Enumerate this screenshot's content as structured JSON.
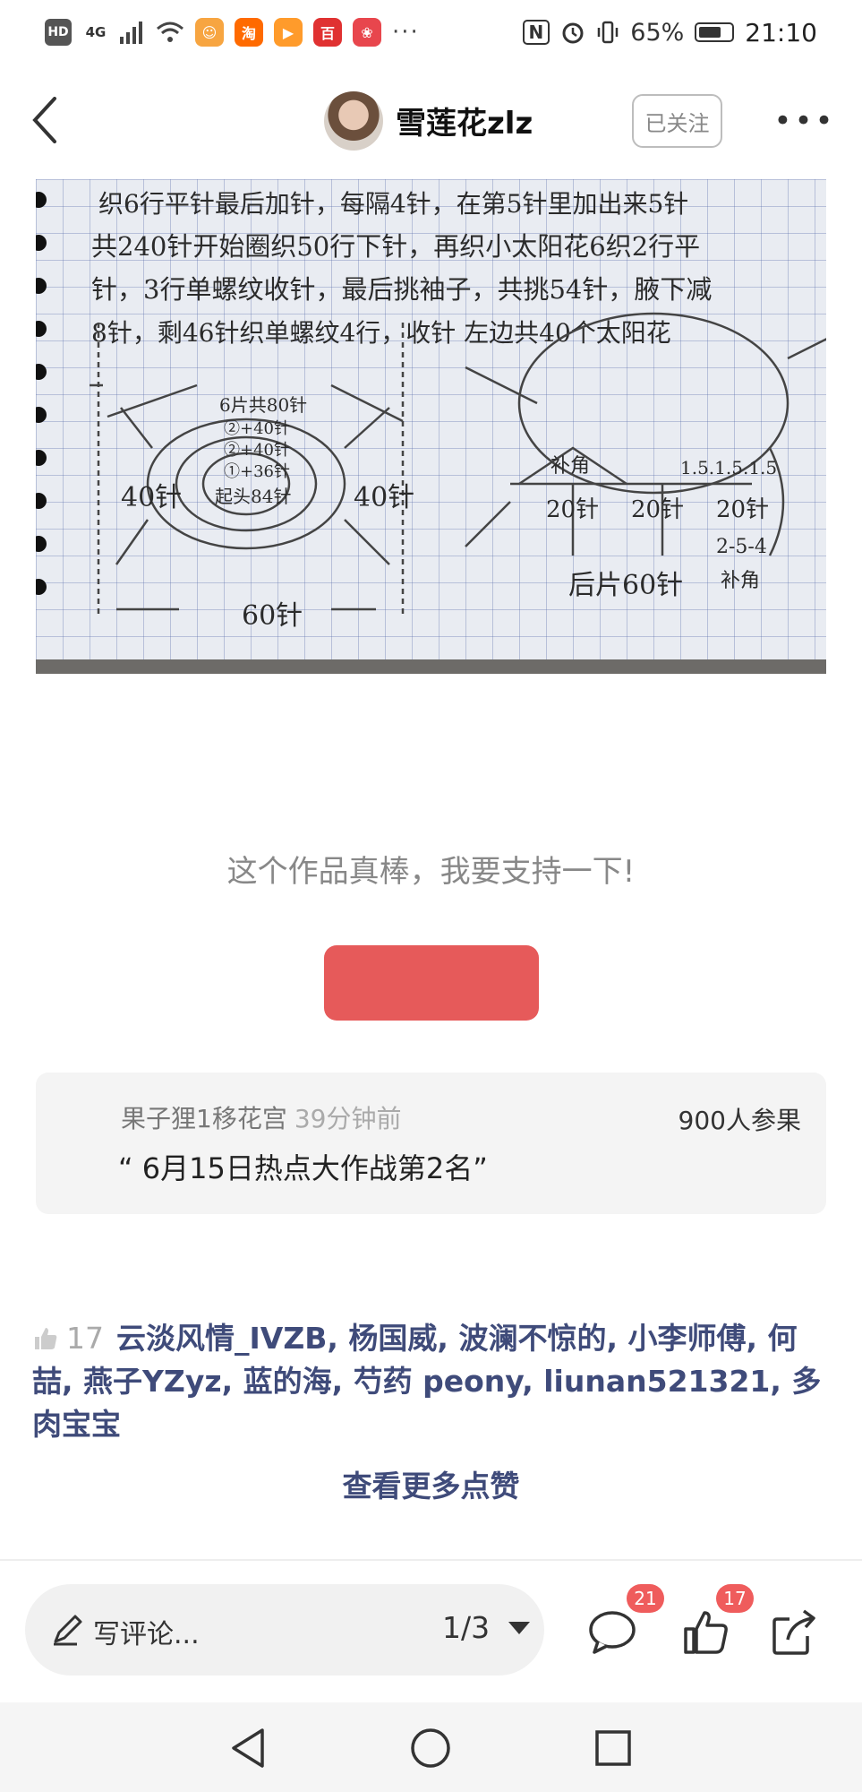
{
  "status_bar": {
    "left_icons": [
      "HD",
      "4G"
    ],
    "app_icons": [
      {
        "name": "pet-app-icon",
        "glyph": "☺",
        "color": "#f7a541"
      },
      {
        "name": "taobao-app-icon",
        "glyph": "淘",
        "color": "#ff6a00"
      },
      {
        "name": "video-app-icon",
        "glyph": "▶",
        "color": "#ff9b2b"
      },
      {
        "name": "shop-app-icon",
        "glyph": "百",
        "color": "#e03131"
      },
      {
        "name": "pinduoduo-app-icon",
        "glyph": "❀",
        "color": "#e8464d"
      }
    ],
    "more": "···",
    "nfc": "N",
    "battery": "65%",
    "time": "21:10"
  },
  "header": {
    "username": "雪莲花zlz",
    "follow_label": "已关注",
    "more_label": "•••"
  },
  "photo": {
    "handwritten_lines": [
      "织6行平针最后加针，每隔4针，在第5针里加出来5针",
      "共240针开始圈织50行下针，再织小太阳花6织2行平",
      "针，3行单螺纹收针，最后挑袖子，共挑54针，腋下减",
      "8针，剩46针织单螺纹4行，收针  左边共40个太阳花"
    ],
    "left_diagram": {
      "rings": [
        "6片共80针",
        "②+40针",
        "②+40针",
        "①+36针",
        "起头84针"
      ],
      "left_label": "40针",
      "right_label": "40针",
      "bottom_label": "60针"
    },
    "right_diagram": {
      "top_left_label": "补角",
      "segments": [
        "20针",
        "20针",
        "20针"
      ],
      "pattern": "1.5.1.5.1.5",
      "sequence": "2-5-4",
      "corner_label": "补角",
      "bottom_label": "后片60针"
    }
  },
  "support": {
    "text": "这个作品真棒，我要支持一下!"
  },
  "quote_card": {
    "author": "果子狸1移花宫",
    "time": "39分钟前",
    "count": "900人参果",
    "text": "“ 6月15日热点大作战第2名”"
  },
  "likes": {
    "count": "17",
    "names": "云淡风情_IVZB, 杨国威, 波澜不惊的, 小李师傅, 何喆, 燕子YZyz, 蓝的海, 芍药 peony, liunan521321, 多肉宝宝",
    "see_more": "查看更多点赞"
  },
  "bottom_bar": {
    "comment_placeholder": "写评论...",
    "page_indicator": "1/3",
    "comment_badge": "21",
    "like_badge": "17"
  },
  "colors": {
    "support_button": "#e65a5a",
    "badge": "#ef5c5c",
    "link": "#3f4b7a"
  }
}
